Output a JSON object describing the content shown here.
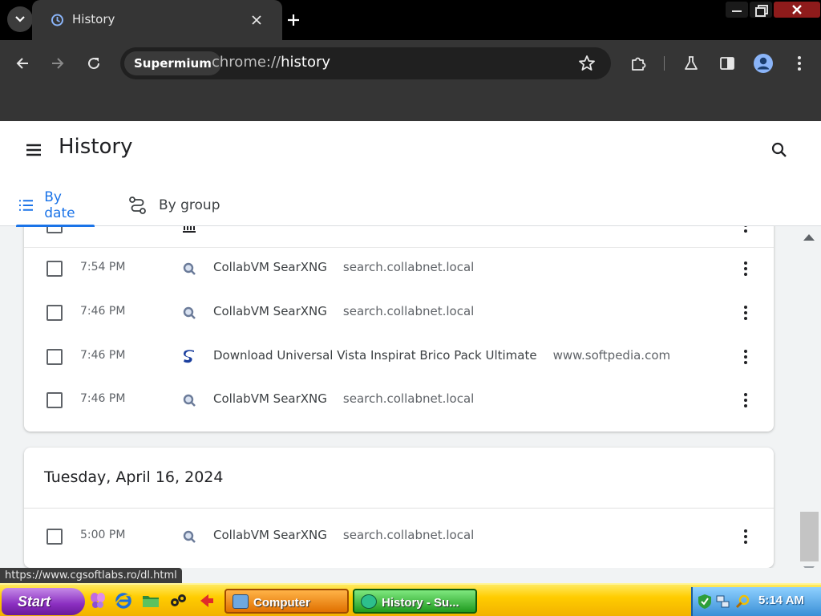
{
  "browser": {
    "tab": {
      "title": "History"
    },
    "site_chip": "Supermium",
    "url_scheme": "chrome://",
    "url_host": "history"
  },
  "page": {
    "title": "History",
    "tabs": [
      {
        "label": "By date",
        "selected": true
      },
      {
        "label": "By group",
        "selected": false
      }
    ]
  },
  "groups": [
    {
      "date": "",
      "entries": [
        {
          "time": "7:54 PM",
          "title": "CollabVM SearXNG",
          "domain": "search.collabnet.local",
          "favicon": "searxng-icon"
        },
        {
          "time": "7:46 PM",
          "title": "CollabVM SearXNG",
          "domain": "search.collabnet.local",
          "favicon": "searxng-icon"
        },
        {
          "time": "7:46 PM",
          "title": "Download Universal Vista Inspirat Brico Pack Ultimate",
          "domain": "www.softpedia.com",
          "favicon": "softpedia-icon"
        },
        {
          "time": "7:46 PM",
          "title": "CollabVM SearXNG",
          "domain": "search.collabnet.local",
          "favicon": "searxng-icon"
        }
      ]
    },
    {
      "date": "Tuesday, April 16, 2024",
      "entries": [
        {
          "time": "5:00 PM",
          "title": "CollabVM SearXNG",
          "domain": "search.collabnet.local",
          "favicon": "searxng-icon"
        }
      ]
    }
  ],
  "status_bubble": "https://www.cgsoftlabs.ro/dl.html",
  "taskbar": {
    "start_label": "Start",
    "tasks": [
      {
        "label": "Computer"
      },
      {
        "label": "History - Su..."
      }
    ],
    "clock": "5:14 AM"
  },
  "colors": {
    "accent": "#1a73e8",
    "chrome_dark": "#353535",
    "taskbar": "#ffcc00"
  }
}
